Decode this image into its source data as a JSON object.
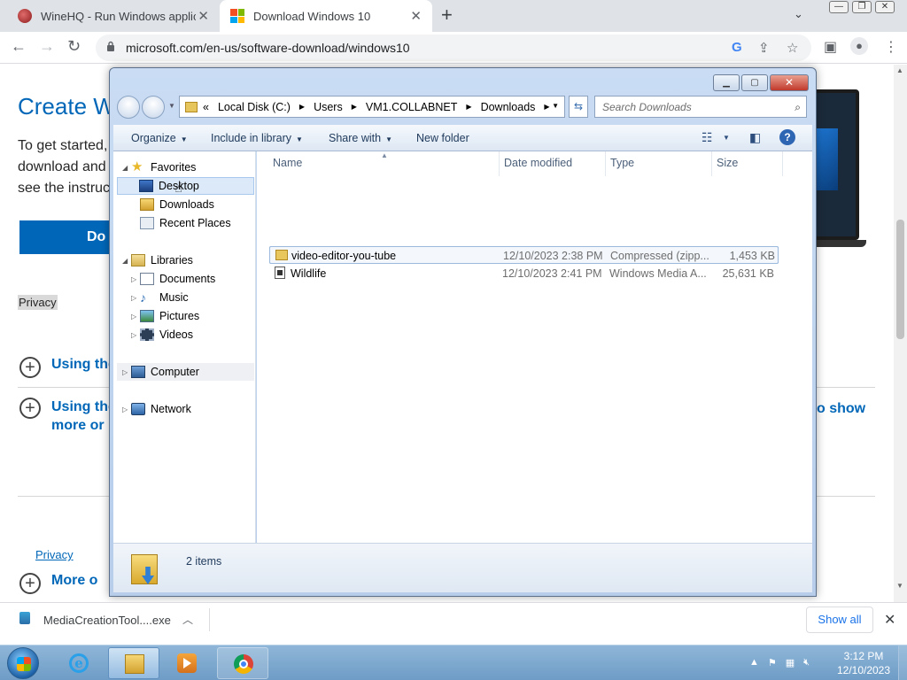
{
  "browser": {
    "tabs": [
      {
        "title": "WineHQ - Run Windows applicat",
        "active": false
      },
      {
        "title": "Download Windows 10",
        "active": true
      }
    ],
    "url": "microsoft.com/en-us/software-download/windows10"
  },
  "webpage": {
    "heading": "Create W",
    "intro_lines": [
      "To get started,",
      "download and",
      "see the instruc"
    ],
    "download_button": "Do",
    "privacy_highlight": "Privacy",
    "accordion": [
      {
        "line1": "Using the",
        "line2": ""
      },
      {
        "line1": "Using the",
        "line2": "more or l"
      }
    ],
    "to_show_text": "o show",
    "privacy_link": "Privacy",
    "more_text": "More o"
  },
  "explorer": {
    "address_segments": [
      "«",
      "Local Disk (C:)",
      "Users",
      "VM1.COLLABNET",
      "Downloads"
    ],
    "search_placeholder": "Search Downloads",
    "commands": {
      "organize": "Organize",
      "include_in_library": "Include in library",
      "share_with": "Share with",
      "new_folder": "New folder"
    },
    "nav": {
      "favorites": "Favorites",
      "desktop": "Desktop",
      "downloads": "Downloads",
      "recent_places": "Recent Places",
      "libraries": "Libraries",
      "documents": "Documents",
      "music": "Music",
      "pictures": "Pictures",
      "videos": "Videos",
      "computer": "Computer",
      "network": "Network"
    },
    "columns": {
      "name": "Name",
      "date": "Date modified",
      "type": "Type",
      "size": "Size"
    },
    "files": [
      {
        "name": "video-editor-you-tube",
        "date": "12/10/2023 2:38 PM",
        "type": "Compressed (zipp...",
        "size": "1,453 KB"
      },
      {
        "name": "Wildlife",
        "date": "12/10/2023 2:41 PM",
        "type": "Windows Media A...",
        "size": "25,631 KB"
      }
    ],
    "item_count": "2 items"
  },
  "download_shelf": {
    "filename": "MediaCreationTool....exe",
    "show_all": "Show all"
  },
  "taskbar": {
    "time": "3:12 PM",
    "date": "12/10/2023"
  },
  "colors": {
    "ms_blue": "#0067b8",
    "explorer_frame": "#c9dcf3",
    "taskbar": "#7ea9d0"
  }
}
